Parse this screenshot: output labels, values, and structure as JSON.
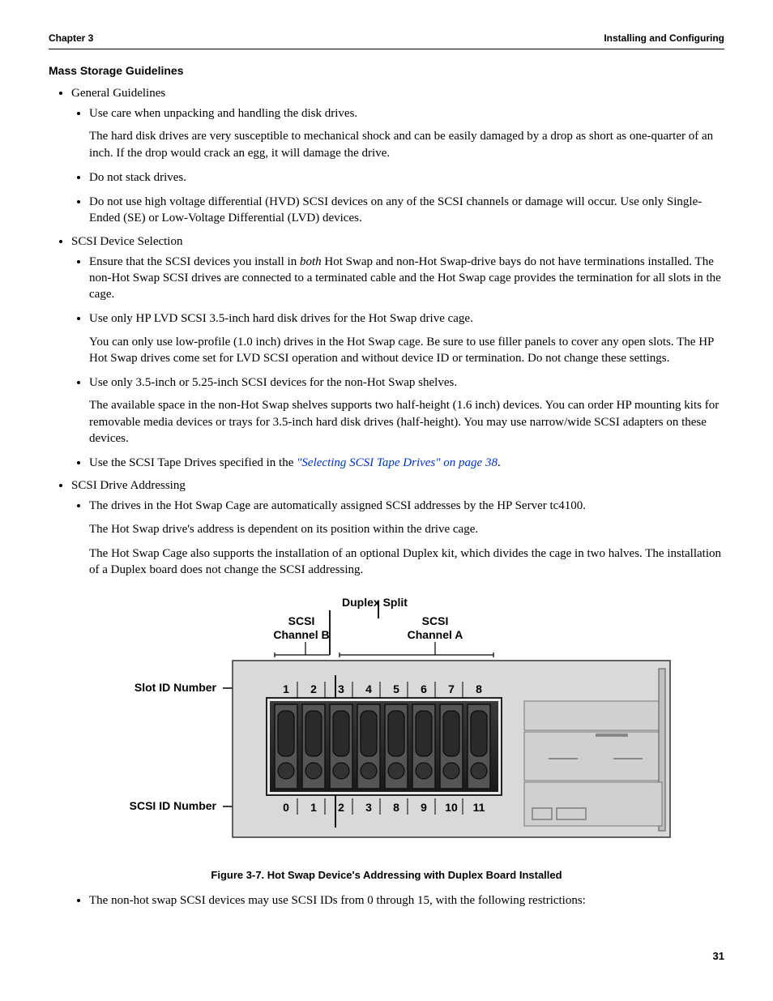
{
  "header": {
    "left": "Chapter 3",
    "right": "Installing and Configuring"
  },
  "section_title": "Mass Storage Guidelines",
  "general_guidelines": {
    "title": "General Guidelines",
    "items": {
      "i0": {
        "text": "Use care when unpacking and handling the disk drives.",
        "para": "The hard disk drives are very susceptible to mechanical shock and can be easily damaged by a drop as short as one-quarter of an inch. If the drop would crack an egg, it will damage the drive."
      },
      "i1": {
        "text": "Do not stack drives."
      },
      "i2": {
        "text": "Do not use high voltage differential (HVD) SCSI devices on any of the SCSI channels or damage will occur. Use only Single-Ended (SE) or Low-Voltage Differential (LVD) devices."
      }
    }
  },
  "scsi_selection": {
    "title": "SCSI Device Selection",
    "items": {
      "i0": {
        "prefix": "Ensure that the SCSI devices you install in ",
        "emph": "both",
        "suffix": " Hot Swap and non-Hot Swap-drive bays do not have terminations installed. The non-Hot Swap SCSI drives are connected to a terminated cable and the Hot Swap cage provides the termination for all slots in the cage."
      },
      "i1": {
        "text": "Use only HP LVD SCSI 3.5-inch hard disk drives for the Hot Swap drive cage.",
        "para": "You can only use low-profile (1.0 inch) drives in the Hot Swap cage. Be sure to use filler panels to cover any open slots. The HP Hot Swap drives come set for LVD SCSI operation and without device ID or termination. Do not change these settings."
      },
      "i2": {
        "text": "Use only 3.5-inch or 5.25-inch SCSI devices for the non-Hot Swap shelves.",
        "para": "The available space in the non-Hot Swap shelves supports two half-height (1.6 inch) devices. You can order HP mounting kits for removable media devices or trays for 3.5-inch hard disk drives (half-height). You may use narrow/wide SCSI adapters on these devices."
      },
      "i3": {
        "prefix": "Use the SCSI Tape Drives specified in the ",
        "link": "\"Selecting SCSI Tape Drives\" on page 38",
        "suffix": "."
      }
    }
  },
  "scsi_addressing": {
    "title": "SCSI Drive Addressing",
    "items": {
      "i0": {
        "text": "The drives in the Hot Swap Cage are automatically assigned SCSI addresses by the HP Server tc4100.",
        "para1": "The Hot Swap drive's address is dependent on its position within the drive cage.",
        "para2": "The Hot Swap Cage also supports the installation of an optional Duplex kit, which divides the cage in two halves. The installation of a Duplex board does not change the SCSI addressing."
      },
      "i1": {
        "text": "The non-hot swap SCSI devices may use SCSI IDs from 0 through 15, with the following restrictions:"
      }
    }
  },
  "figure": {
    "caption": "Figure 3-7.  Hot Swap Device's Addressing with Duplex Board Installed",
    "labels": {
      "duplex_split": "Duplex Split",
      "channel_b_l1": "SCSI",
      "channel_b_l2": "Channel B",
      "channel_a_l1": "SCSI",
      "channel_a_l2": "Channel A",
      "slot_id": "Slot ID  Number",
      "scsi_id": "SCSI ID Number"
    },
    "slot_ids": [
      "1",
      "2",
      "3",
      "4",
      "5",
      "6",
      "7",
      "8"
    ],
    "scsi_ids": [
      "0",
      "1",
      "2",
      "3",
      "8",
      "9",
      "10",
      "11"
    ]
  },
  "page_number": "31"
}
